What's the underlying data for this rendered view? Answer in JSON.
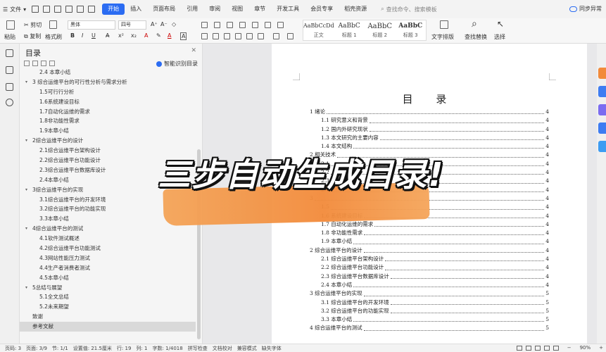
{
  "menubar": {
    "file": "文件",
    "tabs": [
      "开始",
      "插入",
      "页面布局",
      "引用",
      "审阅",
      "视图",
      "章节",
      "开发工具",
      "会员专享",
      "稻壳资源"
    ],
    "active_tab": "开始",
    "search_placeholder": "查找命令、搜索模板",
    "sync": "同步异常"
  },
  "ribbon": {
    "paste": "粘贴",
    "cut": "剪切",
    "copy": "复制",
    "format_painter": "格式刷",
    "font_name": "黑体",
    "font_size": "四号",
    "styles": [
      {
        "sample": "AaBbCcDd",
        "label": "正文"
      },
      {
        "sample": "AaBbC",
        "label": "标题 1"
      },
      {
        "sample": "AaBbC",
        "label": "标题 2"
      },
      {
        "sample": "AaBbC",
        "label": "标题 3"
      }
    ],
    "text_layout": "文字排版",
    "find_replace": "查找替换",
    "select": "选择"
  },
  "toc_panel": {
    "title": "目录",
    "smart_recognize": "智能识别目录",
    "items": [
      {
        "text": "2.4 本章小结",
        "level": 2
      },
      {
        "text": "3 综合运维平台的可行性分析与需求分析",
        "level": 1
      },
      {
        "text": "1.5可行行分析",
        "level": 2
      },
      {
        "text": "1.6系统建设目标",
        "level": 2
      },
      {
        "text": "1.7自动化运维的需求",
        "level": 2
      },
      {
        "text": "1.8非功能性需求",
        "level": 2
      },
      {
        "text": "1.9本章小结",
        "level": 2
      },
      {
        "text": "2综合运维平台的设计",
        "level": 1
      },
      {
        "text": "2.1综合运维平台架构设计",
        "level": 2
      },
      {
        "text": "2.2综合运维平台功能设计",
        "level": 2
      },
      {
        "text": "2.3综合运维平台数据库设计",
        "level": 2
      },
      {
        "text": "2.4本章小结",
        "level": 2
      },
      {
        "text": "3综合运维平台的实现",
        "level": 1
      },
      {
        "text": "3.1综合运维平台的开发环境",
        "level": 2
      },
      {
        "text": "3.2综合运维平台的功能实现",
        "level": 2
      },
      {
        "text": "3.3本章小结",
        "level": 2
      },
      {
        "text": "4综合运维平台的测试",
        "level": 1
      },
      {
        "text": "4.1软件测试概述",
        "level": 2
      },
      {
        "text": "4.2综合运维平台功能测试",
        "level": 2
      },
      {
        "text": "4.3网站性能压力测试",
        "level": 2
      },
      {
        "text": "4.4生产者消费者测试",
        "level": 2
      },
      {
        "text": "4.5本章小结",
        "level": 2
      },
      {
        "text": "5总结与展望",
        "level": 1
      },
      {
        "text": "5.1全文总结",
        "level": 2
      },
      {
        "text": "5.2未来期望",
        "level": 2
      },
      {
        "text": "致谢",
        "level": 0
      },
      {
        "text": "参考文献",
        "level": 0,
        "selected": true
      }
    ]
  },
  "document": {
    "title": "目 录",
    "lines": [
      {
        "text": "1 绪论",
        "page": "4",
        "level": 1
      },
      {
        "text": "1.1 研究意义和背景",
        "page": "4",
        "level": 2
      },
      {
        "text": "1.2 国内外研究现状",
        "page": "4",
        "level": 2
      },
      {
        "text": "1.3 本文研究的主要内容",
        "page": "4",
        "level": 2
      },
      {
        "text": "1.4 本文结构",
        "page": "4",
        "level": 2
      },
      {
        "text": "2 相关技术",
        "page": "4",
        "level": 1
      },
      {
        "text": "2.1",
        "page": "4",
        "level": 2
      },
      {
        "text": "2.2",
        "page": "4",
        "level": 2
      },
      {
        "text": "2.3",
        "page": "4",
        "level": 2
      },
      {
        "text": "2.4",
        "page": "4",
        "level": 2
      },
      {
        "text": "3",
        "page": "4",
        "level": 1
      },
      {
        "text": "1.5",
        "page": "4",
        "level": 2
      },
      {
        "text": "1.6 系统建设目标",
        "page": "4",
        "level": 2
      },
      {
        "text": "1.7 自动化运维的需求",
        "page": "4",
        "level": 2
      },
      {
        "text": "1.8 非功能性需求",
        "page": "4",
        "level": 2
      },
      {
        "text": "1.9 本章小结",
        "page": "4",
        "level": 2
      },
      {
        "text": "2 综合运维平台的设计",
        "page": "4",
        "level": 1
      },
      {
        "text": "2.1 综合运维平台架构设计",
        "page": "4",
        "level": 2
      },
      {
        "text": "2.2 综合运维平台功能设计",
        "page": "4",
        "level": 2
      },
      {
        "text": "2.3 综合运维平台数据库设计",
        "page": "4",
        "level": 2
      },
      {
        "text": "2.4 本章小结",
        "page": "4",
        "level": 2
      },
      {
        "text": "3 综合运维平台的实现",
        "page": "5",
        "level": 1
      },
      {
        "text": "3.1 综合运维平台的开发环境",
        "page": "5",
        "level": 2
      },
      {
        "text": "3.2 综合运维平台的功能实现",
        "page": "5",
        "level": 2
      },
      {
        "text": "3.3 本章小结",
        "page": "5",
        "level": 2
      },
      {
        "text": "4 综合运维平台的测试",
        "page": "5",
        "level": 1
      }
    ]
  },
  "overlay": {
    "headline": "三步自动生成目录!"
  },
  "statusbar": {
    "page_count": "页码: 3",
    "page": "页面: 3/9",
    "section": "节: 1/1",
    "setting": "设置值: 21.5厘米",
    "row": "行: 19",
    "col": "列: 1",
    "words": "字数: 1/4018",
    "spell": "拼写检查",
    "proof": "文档校对",
    "compat": "兼容模式",
    "missing_font": "缺失字体",
    "zoom": "90%"
  }
}
